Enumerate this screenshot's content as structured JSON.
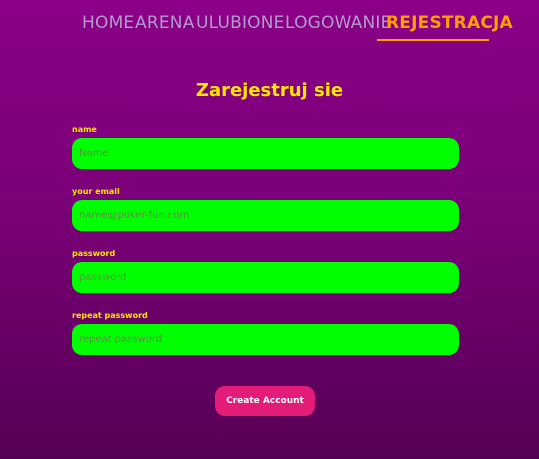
{
  "nav": {
    "items": [
      {
        "label": "HOME"
      },
      {
        "label": "ARENA"
      },
      {
        "label": "ULUBIONE"
      },
      {
        "label": "LOGOWANIE"
      },
      {
        "label": "REJESTRACJA"
      }
    ],
    "active_index": 4,
    "colors": {
      "inactive": "#b39ad0",
      "active": "#ff9e00"
    }
  },
  "page_title": "Zarejestruj sie",
  "form": {
    "fields": [
      {
        "label": "name",
        "placeholder": "Name"
      },
      {
        "label": "your email",
        "placeholder": "name@poker-fun.com"
      },
      {
        "label": "password",
        "placeholder": "password"
      },
      {
        "label": "repeat password",
        "placeholder": "repeat password"
      }
    ],
    "submit_label": "Create Account"
  },
  "colors": {
    "background": "#7a0078",
    "label": "#ffe600",
    "input_bg": "#00ff00",
    "button_bg": "#e31c78"
  }
}
